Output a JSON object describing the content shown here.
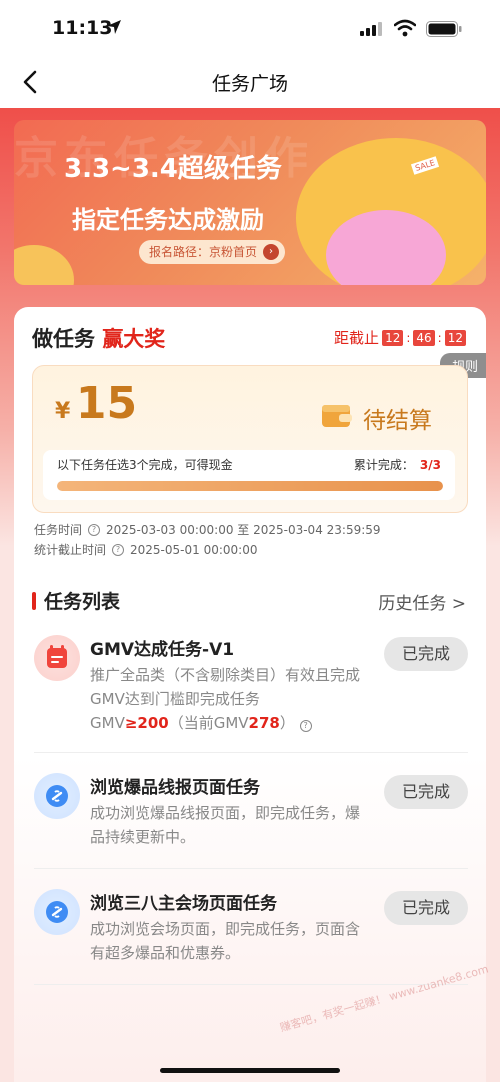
{
  "status_bar": {
    "time": "11:13"
  },
  "nav": {
    "title": "任务广场"
  },
  "banner": {
    "bg_text": "京东任务创作",
    "title": "3.3~3.4超级任务",
    "subtitle": "指定任务达成激励",
    "pill": "报名路径：京粉首页",
    "sale_tag": "SALE"
  },
  "card": {
    "head_prefix": "做任务",
    "head_suffix": "赢大奖",
    "countdown_label": "距截止",
    "countdown": {
      "h": "12",
      "m": "46",
      "s": "12"
    },
    "rules": "规则",
    "reward": {
      "currency": "¥",
      "amount": "15",
      "status": "待结算",
      "desc": "以下任务任选3个完成，可得现金",
      "progress_label": "累计完成：",
      "progress_value": "3/3",
      "progress_fraction": 1.0
    },
    "task_time_label": "任务时间",
    "task_time_value": "2025-03-03 00:00:00 至 2025-03-04 23:59:59",
    "stat_time_label": "统计截止时间",
    "stat_time_value": "2025-05-01 00:00:00"
  },
  "section": {
    "title": "任务列表",
    "history": "历史任务 >"
  },
  "tasks": [
    {
      "name": "GMV达成任务-V1",
      "desc": "推广全品类（不含剔除类目）有效且完成GMV达到门槛即完成任务",
      "gmv_prefix": "GMV",
      "gmv_threshold": "≥200",
      "gmv_mid": "（当前GMV",
      "gmv_current": "278",
      "gmv_end": "）",
      "button": "已完成",
      "icon": "calendar-icon"
    },
    {
      "name": "浏览爆品线报页面任务",
      "desc": "成功浏览爆品线报页面，即完成任务，爆品持续更新中。",
      "button": "已完成",
      "icon": "link-icon"
    },
    {
      "name": "浏览三八主会场页面任务",
      "desc": "成功浏览会场页面，即完成任务，页面含有超多爆品和优惠券。",
      "button": "已完成",
      "icon": "link-icon"
    }
  ],
  "watermark": "赚客吧，有奖一起赚！ www.zuanke8.com",
  "colors": {
    "accent": "#e1251b",
    "gold": "#c8791d"
  }
}
